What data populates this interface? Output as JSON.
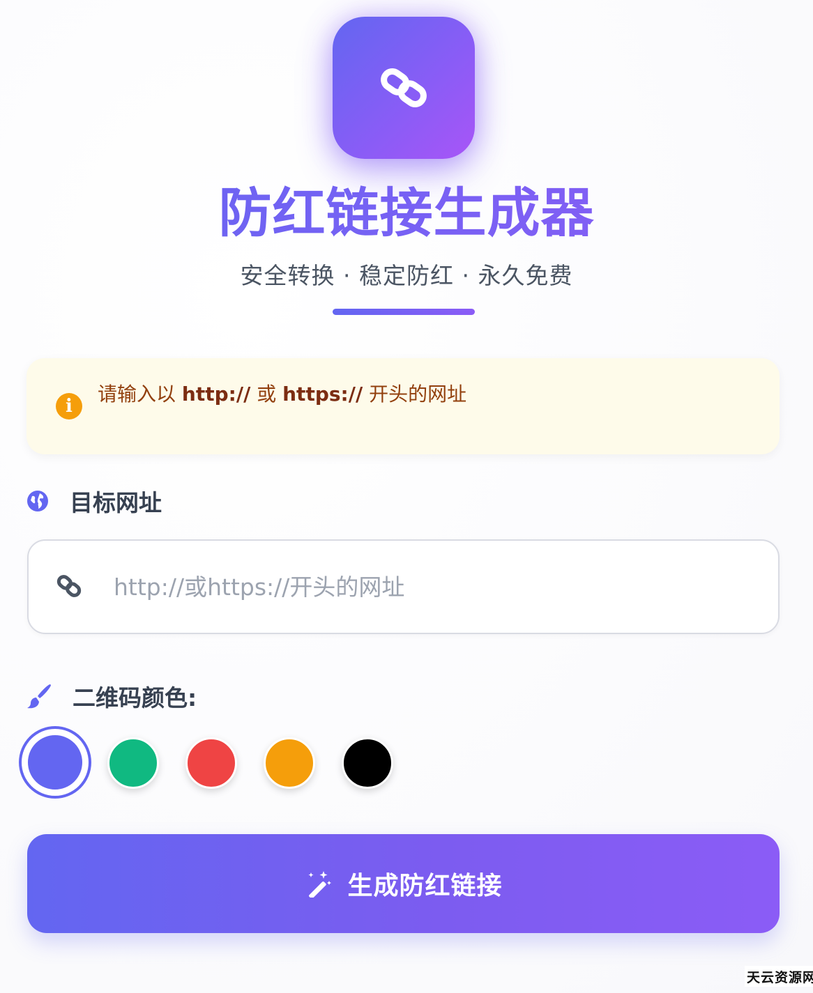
{
  "header": {
    "logo_icon": "link-icon",
    "title": "防红链接生成器",
    "subtitle": "安全转换 · 稳定防红 · 永久免费"
  },
  "notice": {
    "icon": "info-icon",
    "text_before": "请输入以 ",
    "http": "http://",
    "or": " 或 ",
    "https": "https://",
    "text_after": " 开头的网址"
  },
  "url_field": {
    "label_icon": "globe-icon",
    "label": "目标网址",
    "input_icon": "link-icon",
    "placeholder": "http://或https://开头的网址",
    "value": ""
  },
  "color_picker": {
    "label_icon": "brush-icon",
    "label": "二维码颜色:",
    "options": [
      {
        "name": "indigo",
        "color": "#6366f1",
        "selected": true
      },
      {
        "name": "green",
        "color": "#10b981",
        "selected": false
      },
      {
        "name": "red",
        "color": "#ef4444",
        "selected": false
      },
      {
        "name": "orange",
        "color": "#f59e0b",
        "selected": false
      },
      {
        "name": "black",
        "color": "#000000",
        "selected": false
      }
    ]
  },
  "generate_button": {
    "icon": "magic-wand-icon",
    "label": "生成防红链接"
  },
  "watermark": "天云资源网",
  "colors": {
    "primary": "#6366f1",
    "secondary": "#8b5cf6",
    "notice_bg": "#fefbea",
    "notice_text": "#92400e"
  }
}
